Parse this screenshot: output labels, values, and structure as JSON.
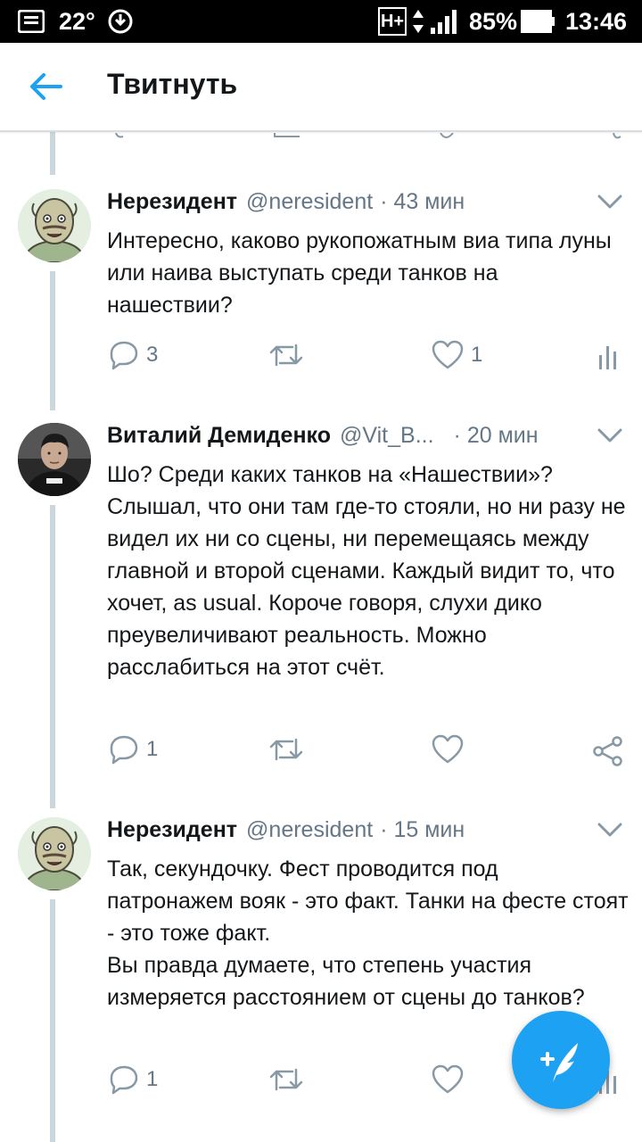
{
  "status_bar": {
    "temperature": "22°",
    "network": "H+",
    "battery": "85%",
    "time": "13:46"
  },
  "header": {
    "title": "Твитнуть"
  },
  "tweets": [
    {
      "name": "Нерезидент",
      "handle": "@neresident",
      "time": "· 43 мин",
      "text": "Интересно, каково рукопожатным виа типа луны или наива выступать среди танков на нашествии?",
      "replies": "3",
      "likes": "1",
      "last_action": "analytics-icon"
    },
    {
      "name": "Виталий Демиденко",
      "handle": "@Vit_B...",
      "time": "· 20 мин",
      "text": "Шо? Среди каких танков на «Нашествии»? Слышал, что они там где-то стояли, но ни разу не видел их ни со сцены, ни перемещаясь между главной и второй сценами. Каждый видит то, что хочет, as usual. Короче говоря, слухи дико преувеличивают реальность. Можно расслабиться на этот счёт.",
      "replies": "1",
      "likes": "",
      "last_action": "share-icon"
    },
    {
      "name": "Нерезидент",
      "handle": "@neresident",
      "time": "· 15 мин",
      "text": "Так, секундочку. Фест проводится под патронажем вояк - это факт. Танки на фесте стоят - это тоже факт.\nВы правда думаете, что степень участия измеряется расстоянием от сцены до танков?",
      "replies": "1",
      "likes": "",
      "last_action": "analytics-icon"
    }
  ],
  "colors": {
    "accent": "#1da1f2",
    "secondary_text": "#657786",
    "thread_line": "#ccd6dd"
  }
}
